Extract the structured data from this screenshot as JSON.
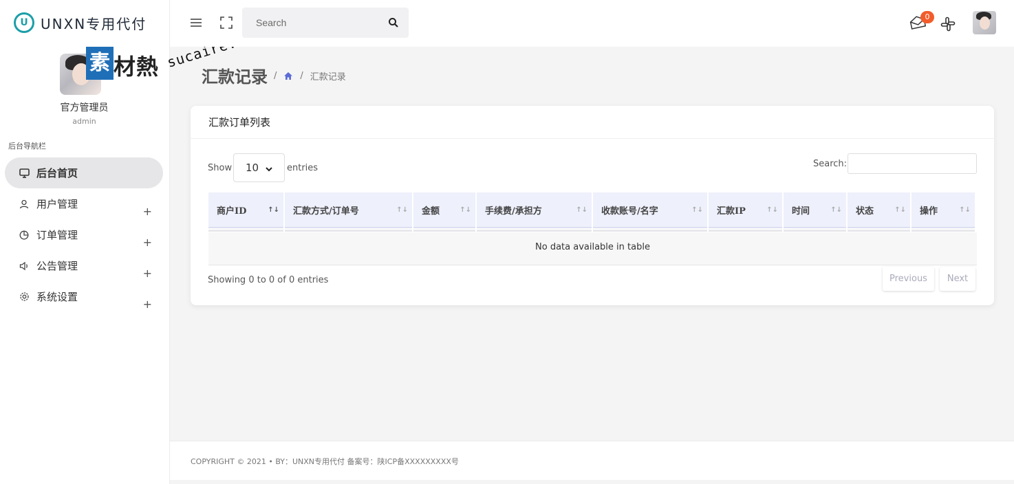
{
  "brand": {
    "name": "UNXN专用代付",
    "logo_letter": "U"
  },
  "watermark": {
    "cn": "素材熱",
    "url": "sucaire.com",
    "box_char": "素",
    "rest": "材熱"
  },
  "profile": {
    "name": "官方管理员",
    "role": "admin"
  },
  "sidebar": {
    "section_title": "后台导航栏",
    "items": [
      {
        "label": "后台首页",
        "icon": "monitor-icon",
        "active": true,
        "expandable": false
      },
      {
        "label": "用户管理",
        "icon": "user-icon",
        "active": false,
        "expandable": true
      },
      {
        "label": "订单管理",
        "icon": "pie-chart-icon",
        "active": false,
        "expandable": true
      },
      {
        "label": "公告管理",
        "icon": "speaker-icon",
        "active": false,
        "expandable": true
      },
      {
        "label": "系统设置",
        "icon": "gear-icon",
        "active": false,
        "expandable": true
      }
    ],
    "plus": "+"
  },
  "topbar": {
    "search_placeholder": "Search",
    "notification_count": "0"
  },
  "page": {
    "title": "汇款记录",
    "breadcrumb_sep": "/",
    "breadcrumb_current": "汇款记录"
  },
  "card": {
    "title": "汇款订单列表",
    "length": {
      "show": "Show",
      "value": "10",
      "entries": "entries"
    },
    "filter_label": "Search:",
    "columns": [
      {
        "label": "商户ID",
        "sort": "↑↓",
        "active": true
      },
      {
        "label": "汇款方式/订单号",
        "sort": "↑↓",
        "active": false
      },
      {
        "label": "金额",
        "sort": "↑↓",
        "active": false
      },
      {
        "label": "手续费/承担方",
        "sort": "↑↓",
        "active": false
      },
      {
        "label": "收款账号/名字",
        "sort": "↑↓",
        "active": false
      },
      {
        "label": "汇款IP",
        "sort": "↑↓",
        "active": false
      },
      {
        "label": "时间",
        "sort": "↑↓",
        "active": false
      },
      {
        "label": "状态",
        "sort": "↑↓",
        "active": false
      },
      {
        "label": "操作",
        "sort": "↑↓",
        "active": false
      }
    ],
    "empty_text": "No data available in table",
    "info": "Showing 0 to 0 of 0 entries",
    "prev": "Previous",
    "next": "Next"
  },
  "footer": {
    "text": "COPYRIGHT © 2021 • BY：UNXN专用代付   备案号：陕ICP备XXXXXXXXX号"
  },
  "colors": {
    "accent": "#1c9ea8",
    "header_bg": "#eef0fc",
    "badge": "#f25c2b",
    "home_icon": "#5b6bd6"
  }
}
